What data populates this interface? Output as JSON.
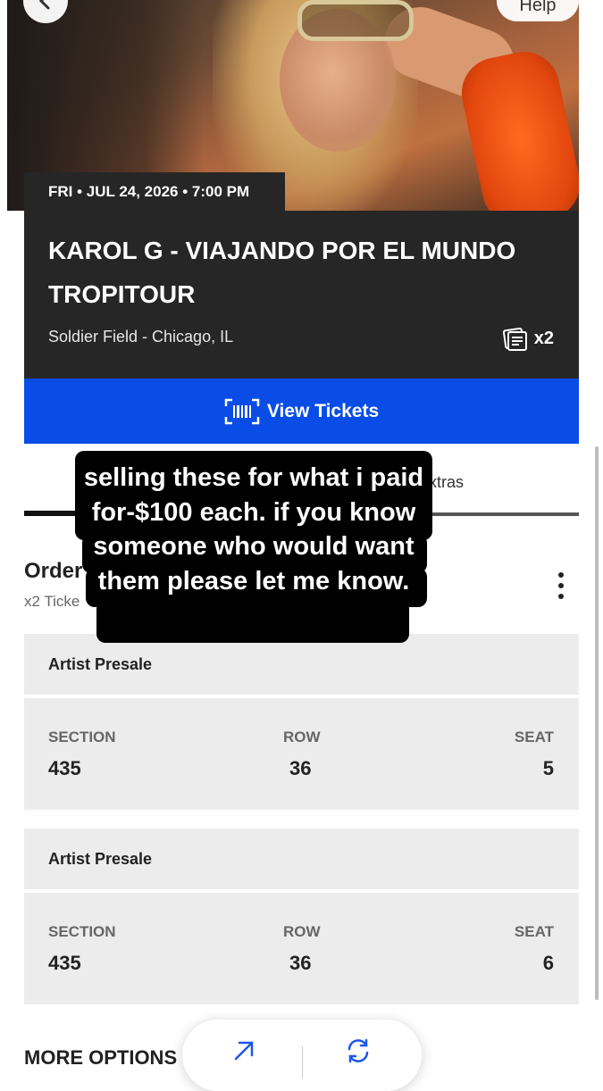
{
  "header": {
    "help_label": "Help"
  },
  "event": {
    "date_time": "FRI • JUL 24, 2026 • 7:00 PM",
    "title": "KAROL G - VIAJANDO POR EL MUNDO TROPITOUR",
    "venue": "Soldier Field - Chicago, IL",
    "ticket_count": "x2"
  },
  "actions": {
    "view_tickets_label": "View Tickets"
  },
  "tabs": {
    "partial_label": "xtras"
  },
  "order": {
    "title": "Order",
    "subtitle": "x2 Ticke"
  },
  "tickets": [
    {
      "presale": "Artist Presale",
      "section_label": "SECTION",
      "section": "435",
      "row_label": "ROW",
      "row": "36",
      "seat_label": "SEAT",
      "seat": "5"
    },
    {
      "presale": "Artist Presale",
      "section_label": "SECTION",
      "section": "435",
      "row_label": "ROW",
      "row": "36",
      "seat_label": "SEAT",
      "seat": "6"
    }
  ],
  "more_options_label": "MORE OPTIONS",
  "caption_overlay": "selling these for what i paid for-$100 each. if you know someone who would want them please let me know.",
  "colors": {
    "card_dark": "#262626",
    "primary_blue": "#0a4de6",
    "ticket_bg": "#ececec"
  },
  "icons": {
    "back": "chevron-left-icon",
    "ticket": "ticket-icon",
    "barcode": "barcode-icon",
    "kebab": "more-vertical-icon",
    "transfer": "arrow-up-right-icon",
    "resell": "refresh-icon"
  }
}
